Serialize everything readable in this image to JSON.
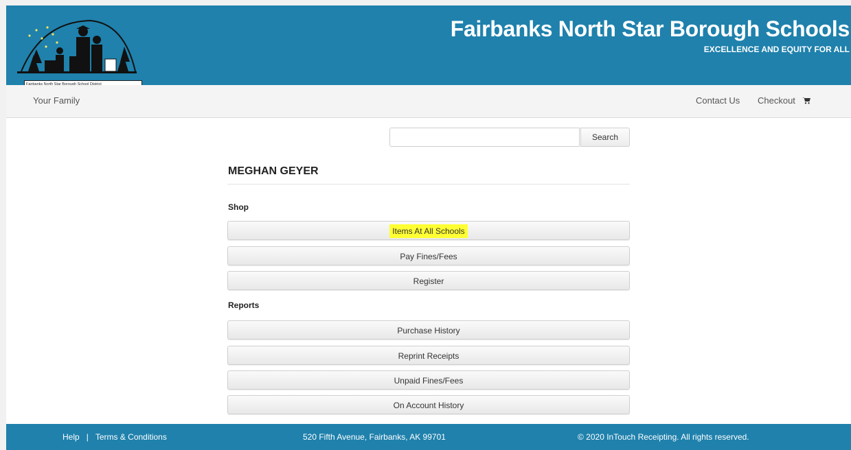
{
  "header": {
    "logo_text": "Fairbanks North Star Borough School District",
    "title": "Fairbanks North Star Borough Schools",
    "tagline": "EXCELLENCE AND EQUITY FOR ALL"
  },
  "nav": {
    "left": "Your Family",
    "contact": "Contact Us",
    "checkout": "Checkout",
    "checkout_icon": "cart-icon"
  },
  "search": {
    "value": "",
    "placeholder": "",
    "button_label": "Search"
  },
  "user_name": "MEGHAN GEYER",
  "shop": {
    "title": "Shop",
    "items": [
      "Items At All Schools",
      "Pay Fines/Fees",
      "Register"
    ],
    "highlighted_item": "Items At All Schools",
    "highlight_color": "#ffff33"
  },
  "reports": {
    "title": "Reports",
    "items": [
      "Purchase History",
      "Reprint Receipts",
      "Unpaid Fines/Fees",
      "On Account History"
    ]
  },
  "footer": {
    "help": "Help",
    "separator": "|",
    "terms": "Terms & Conditions",
    "address": "520 Fifth Avenue, Fairbanks, AK 99701",
    "copyright": "© 2020 InTouch Receipting. All rights reserved."
  },
  "colors": {
    "brand_blue": "#1f81ac",
    "nav_bg": "#f4f4f4"
  }
}
